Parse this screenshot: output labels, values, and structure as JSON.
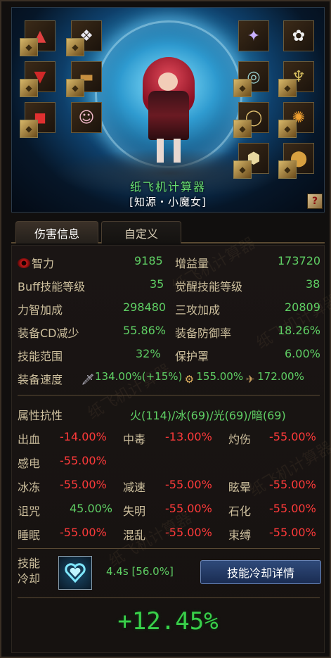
{
  "character": {
    "name": "纸飞机计算器",
    "class": "[知源・小魔女]",
    "help_symbol": "?"
  },
  "equipment": {
    "left_slots": [
      "hat-icon",
      "shoulder-icon",
      "top-icon",
      "belt-icon",
      "bottom-icon",
      "shoes-icon"
    ],
    "right_slots": [
      "weapon-icon",
      "title-icon",
      "bracelet-icon",
      "necklace-icon",
      "ring-icon",
      "support-icon",
      "magic-stone-icon",
      "earring-icon"
    ]
  },
  "tabs": {
    "damage_info": "伤害信息",
    "custom": "自定义"
  },
  "stats": {
    "intelligence_label": "智力",
    "intelligence_value": "9185",
    "gain_label": "增益量",
    "gain_value": "173720",
    "buff_skill_level_label": "Buff技能等级",
    "buff_skill_level_value": "35",
    "awakening_skill_level_label": "觉醒技能等级",
    "awakening_skill_level_value": "38",
    "str_int_bonus_label": "力智加成",
    "str_int_bonus_value": "298480",
    "three_atk_bonus_label": "三攻加成",
    "three_atk_bonus_value": "20809",
    "equip_cd_reduction_label": "装备CD减少",
    "equip_cd_reduction_value": "55.86%",
    "equip_defense_rate_label": "装备防御率",
    "equip_defense_rate_value": "18.26%",
    "skill_range_label": "技能范围",
    "skill_range_value": "32%",
    "shield_label": "保护罩",
    "shield_value": "6.00%",
    "equip_speed_label": "装备速度",
    "attack_speed_value": "134.00%(+15%)",
    "cast_speed_value": "155.00%",
    "move_speed_value": "172.00%"
  },
  "resistance": {
    "label": "属性抗性",
    "values": "火(114)/冰(69)/光(69)/暗(69)"
  },
  "status_effects": [
    {
      "label": "出血",
      "value": "-14.00%",
      "color": "red"
    },
    {
      "label": "中毒",
      "value": "-13.00%",
      "color": "red"
    },
    {
      "label": "灼伤",
      "value": "-55.00%",
      "color": "red"
    },
    {
      "label": "感电",
      "value": "-55.00%",
      "color": "red"
    },
    {
      "label": "冰冻",
      "value": "-55.00%",
      "color": "red"
    },
    {
      "label": "减速",
      "value": "-55.00%",
      "color": "red"
    },
    {
      "label": "眩晕",
      "value": "-55.00%",
      "color": "red"
    },
    {
      "label": "诅咒",
      "value": "45.00%",
      "color": "green"
    },
    {
      "label": "失明",
      "value": "-55.00%",
      "color": "red"
    },
    {
      "label": "石化",
      "value": "-55.00%",
      "color": "red"
    },
    {
      "label": "睡眠",
      "value": "-55.00%",
      "color": "red"
    },
    {
      "label": "混乱",
      "value": "-55.00%",
      "color": "red"
    },
    {
      "label": "束缚",
      "value": "-55.00%",
      "color": "red"
    }
  ],
  "cooldown": {
    "label_line1": "技能",
    "label_line2": "冷却",
    "value": "4.4s [56.0%]",
    "detail_button": "技能冷却详情"
  },
  "total": "+12.45%",
  "colors": {
    "green": "#5fcf64",
    "red": "#ff3a3a",
    "label": "#cdbf9d",
    "name_green": "#68e070"
  }
}
